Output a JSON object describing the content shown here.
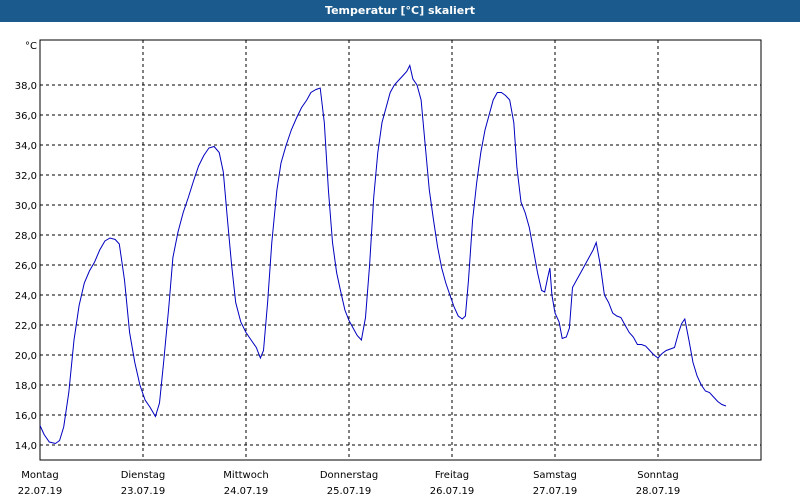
{
  "window": {
    "title": "Temperatur [°C] skaliert"
  },
  "chart_data": {
    "type": "line",
    "title": "Temperatur [°C] skaliert",
    "ylabel": "°C",
    "xlabel": "",
    "ylim": [
      13,
      41
    ],
    "yticks": [
      "14,0",
      "16,0",
      "18,0",
      "20,0",
      "22,0",
      "24,0",
      "26,0",
      "28,0",
      "30,0",
      "32,0",
      "34,0",
      "36,0",
      "38,0"
    ],
    "ytick_values": [
      14,
      16,
      18,
      20,
      22,
      24,
      26,
      28,
      30,
      32,
      34,
      36,
      38
    ],
    "xlim": [
      0,
      7.0
    ],
    "days": [
      {
        "name": "Montag",
        "date": "22.07.19"
      },
      {
        "name": "Dienstag",
        "date": "23.07.19"
      },
      {
        "name": "Mittwoch",
        "date": "24.07.19"
      },
      {
        "name": "Donnerstag",
        "date": "25.07.19"
      },
      {
        "name": "Freitag",
        "date": "26.07.19"
      },
      {
        "name": "Samstag",
        "date": "27.07.19"
      },
      {
        "name": "Sonntag",
        "date": "28.07.19"
      }
    ],
    "grid": true,
    "series": [
      {
        "color": "#0000c0",
        "points": [
          [
            0.0,
            15.3
          ],
          [
            0.04,
            14.7
          ],
          [
            0.09,
            14.2
          ],
          [
            0.15,
            14.1
          ],
          [
            0.19,
            14.3
          ],
          [
            0.23,
            15.2
          ],
          [
            0.28,
            17.5
          ],
          [
            0.33,
            21.0
          ],
          [
            0.38,
            23.3
          ],
          [
            0.43,
            24.8
          ],
          [
            0.48,
            25.6
          ],
          [
            0.53,
            26.2
          ],
          [
            0.58,
            27.0
          ],
          [
            0.63,
            27.6
          ],
          [
            0.68,
            27.8
          ],
          [
            0.73,
            27.7
          ],
          [
            0.77,
            27.4
          ],
          [
            0.82,
            25.0
          ],
          [
            0.87,
            21.5
          ],
          [
            0.92,
            19.5
          ],
          [
            0.97,
            18.0
          ],
          [
            1.02,
            17.0
          ],
          [
            1.07,
            16.5
          ],
          [
            1.12,
            15.9
          ],
          [
            1.16,
            16.8
          ],
          [
            1.2,
            19.5
          ],
          [
            1.25,
            23.2
          ],
          [
            1.29,
            26.5
          ],
          [
            1.34,
            28.2
          ],
          [
            1.39,
            29.5
          ],
          [
            1.44,
            30.5
          ],
          [
            1.49,
            31.6
          ],
          [
            1.54,
            32.6
          ],
          [
            1.59,
            33.3
          ],
          [
            1.64,
            33.8
          ],
          [
            1.69,
            33.9
          ],
          [
            1.74,
            33.5
          ],
          [
            1.78,
            32.2
          ],
          [
            1.82,
            29.0
          ],
          [
            1.86,
            26.0
          ],
          [
            1.9,
            23.5
          ],
          [
            1.95,
            22.2
          ],
          [
            2.0,
            21.5
          ],
          [
            2.05,
            21.0
          ],
          [
            2.1,
            20.5
          ],
          [
            2.14,
            19.8
          ],
          [
            2.17,
            20.3
          ],
          [
            2.21,
            23.5
          ],
          [
            2.25,
            27.5
          ],
          [
            2.3,
            31.0
          ],
          [
            2.34,
            32.8
          ],
          [
            2.39,
            34.0
          ],
          [
            2.44,
            35.0
          ],
          [
            2.49,
            35.8
          ],
          [
            2.54,
            36.5
          ],
          [
            2.59,
            37.0
          ],
          [
            2.63,
            37.5
          ],
          [
            2.68,
            37.7
          ],
          [
            2.72,
            37.8
          ],
          [
            2.76,
            35.5
          ],
          [
            2.8,
            31.0
          ],
          [
            2.84,
            27.5
          ],
          [
            2.88,
            25.5
          ],
          [
            2.92,
            24.2
          ],
          [
            2.96,
            23.0
          ],
          [
            3.0,
            22.3
          ],
          [
            3.04,
            21.8
          ],
          [
            3.08,
            21.3
          ],
          [
            3.12,
            21.0
          ],
          [
            3.16,
            22.5
          ],
          [
            3.2,
            26.0
          ],
          [
            3.24,
            30.5
          ],
          [
            3.28,
            33.5
          ],
          [
            3.32,
            35.5
          ],
          [
            3.36,
            36.5
          ],
          [
            3.4,
            37.5
          ],
          [
            3.44,
            38.0
          ],
          [
            3.48,
            38.3
          ],
          [
            3.52,
            38.6
          ],
          [
            3.56,
            38.9
          ],
          [
            3.59,
            39.3
          ],
          [
            3.62,
            38.4
          ],
          [
            3.66,
            38.0
          ],
          [
            3.7,
            37.0
          ],
          [
            3.74,
            34.0
          ],
          [
            3.78,
            31.0
          ],
          [
            3.82,
            29.0
          ],
          [
            3.86,
            27.2
          ],
          [
            3.9,
            25.8
          ],
          [
            3.94,
            24.8
          ],
          [
            3.98,
            24.0
          ],
          [
            4.02,
            23.2
          ],
          [
            4.06,
            22.6
          ],
          [
            4.1,
            22.4
          ],
          [
            4.13,
            22.6
          ],
          [
            4.16,
            25.0
          ],
          [
            4.2,
            29.0
          ],
          [
            4.24,
            31.5
          ],
          [
            4.28,
            33.5
          ],
          [
            4.32,
            35.0
          ],
          [
            4.36,
            36.0
          ],
          [
            4.4,
            37.0
          ],
          [
            4.44,
            37.5
          ],
          [
            4.48,
            37.5
          ],
          [
            4.52,
            37.3
          ],
          [
            4.56,
            37.0
          ],
          [
            4.6,
            35.5
          ],
          [
            4.63,
            32.5
          ],
          [
            4.67,
            30.2
          ],
          [
            4.71,
            29.5
          ],
          [
            4.75,
            28.5
          ],
          [
            4.79,
            27.0
          ],
          [
            4.83,
            25.5
          ],
          [
            4.87,
            24.3
          ],
          [
            4.9,
            24.2
          ],
          [
            4.93,
            25.2
          ],
          [
            4.95,
            25.8
          ],
          [
            4.97,
            24.0
          ],
          [
            5.0,
            22.8
          ],
          [
            5.04,
            22.2
          ],
          [
            5.07,
            21.1
          ],
          [
            5.11,
            21.2
          ],
          [
            5.14,
            21.8
          ],
          [
            5.17,
            24.5
          ],
          [
            5.21,
            25.0
          ],
          [
            5.25,
            25.5
          ],
          [
            5.29,
            26.0
          ],
          [
            5.33,
            26.5
          ],
          [
            5.37,
            27.0
          ],
          [
            5.4,
            27.5
          ],
          [
            5.44,
            26.0
          ],
          [
            5.48,
            24.0
          ],
          [
            5.52,
            23.5
          ],
          [
            5.56,
            22.8
          ],
          [
            5.6,
            22.6
          ],
          [
            5.64,
            22.5
          ],
          [
            5.68,
            22.0
          ],
          [
            5.72,
            21.5
          ],
          [
            5.76,
            21.2
          ],
          [
            5.8,
            20.7
          ],
          [
            5.84,
            20.7
          ],
          [
            5.88,
            20.6
          ],
          [
            5.92,
            20.3
          ],
          [
            5.96,
            20.0
          ],
          [
            6.0,
            19.8
          ],
          [
            6.04,
            20.1
          ],
          [
            6.08,
            20.3
          ],
          [
            6.12,
            20.4
          ],
          [
            6.16,
            20.5
          ],
          [
            6.2,
            21.5
          ],
          [
            6.23,
            22.1
          ],
          [
            6.26,
            22.4
          ],
          [
            6.3,
            21.0
          ],
          [
            6.34,
            19.5
          ],
          [
            6.38,
            18.6
          ],
          [
            6.42,
            18.0
          ],
          [
            6.46,
            17.6
          ],
          [
            6.5,
            17.5
          ],
          [
            6.54,
            17.2
          ],
          [
            6.58,
            16.9
          ],
          [
            6.62,
            16.7
          ],
          [
            6.66,
            16.6
          ]
        ]
      }
    ]
  }
}
